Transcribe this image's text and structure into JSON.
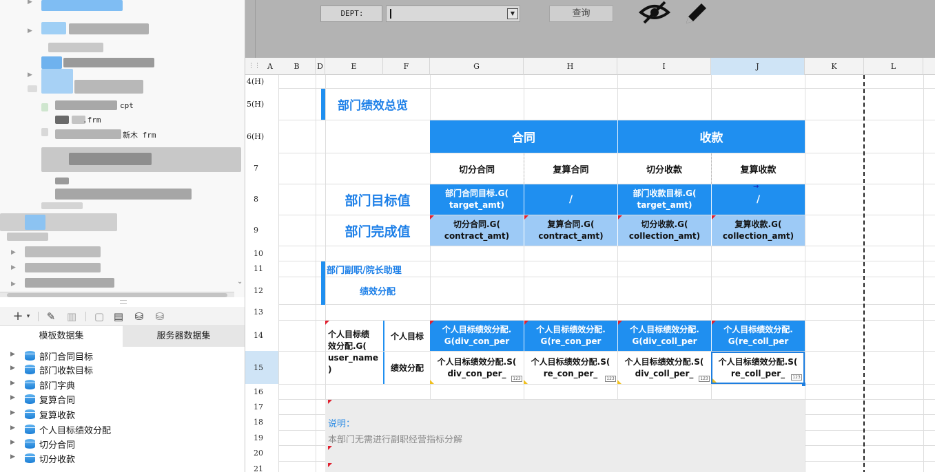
{
  "left_panel": {
    "file_suffixes": [
      "cpt",
      ".frm",
      "新木 frm"
    ],
    "toolbar_icons": [
      "add-icon",
      "edit-icon",
      "delete-icon",
      "preview-icon",
      "edit-dataset-icon",
      "database-icon",
      "database-settings-icon"
    ],
    "tabs": {
      "template": "模板数据集",
      "server": "服务器数据集"
    },
    "datasets": [
      "部门合同目标",
      "部门收款目标",
      "部门字典",
      "复算合同",
      "复算收款",
      "个人目标绩效分配",
      "切分合同",
      "切分收款"
    ]
  },
  "param_bar": {
    "dept_label": "DEPT:",
    "dept_value": "",
    "query_label": "查询"
  },
  "grid": {
    "columns": [
      "A",
      "B",
      "D",
      "E",
      "F",
      "G",
      "H",
      "I",
      "J",
      "K",
      "L"
    ],
    "selected_column": "J",
    "rows": [
      "4(H)",
      "5(H)",
      "6(H)",
      "7",
      "8",
      "9",
      "10",
      "11",
      "12",
      "13",
      "14",
      "15",
      "16",
      "17",
      "18",
      "19",
      "20",
      "21"
    ],
    "cells": {
      "overview_title": "部门绩效总览",
      "contract_header": "合同",
      "collection_header": "收款",
      "split_contract": "切分合同",
      "recalc_contract": "复算合同",
      "split_collection": "切分收款",
      "recalc_collection": "复算收款",
      "dept_target_label": "部门目标值",
      "dept_done_label": "部门完成值",
      "target_contract": "部门合同目标.G(",
      "target_contract_2": "target_amt)",
      "target_slash_h": "/",
      "target_collection": "部门收款目标.G(",
      "target_collection_2": "target_amt)",
      "target_slash_j": "/",
      "done_split_contract": "切分合同.G(",
      "done_split_contract_2": "contract_amt)",
      "done_recalc_contract": "复算合同.G(",
      "done_recalc_contract_2": "contract_amt)",
      "done_split_collection": "切分收款.G(",
      "done_split_collection_2": "collection_amt)",
      "done_recalc_collection": "复算收款.G(",
      "done_recalc_collection_2": "collection_amt)",
      "deputy_title": "部门副职/院长助理",
      "deputy_title_2": "绩效分配",
      "person_field_1": "个人目标绩",
      "person_field_2": "效分配.G(",
      "person_field_3": "user_name",
      "person_field_4": ")",
      "personal_target": "个人目标",
      "perf_alloc": "绩效分配",
      "r14_g_1": "个人目标绩效分配.",
      "r14_g_2": "G(div_con_per",
      "r14_h_1": "个人目标绩效分配.",
      "r14_h_2": "G(re_con_per",
      "r14_i_1": "个人目标绩效分配.",
      "r14_i_2": "G(div_coll_per",
      "r14_j_1": "个人目标绩效分配.",
      "r14_j_2": "G(re_coll_per",
      "r15_g_1": "个人目标绩效分配.S(",
      "r15_g_2": "div_con_per_",
      "r15_h_1": "个人目标绩效分配.S(",
      "r15_h_2": "re_con_per_",
      "r15_i_1": "个人目标绩效分配.S(",
      "r15_i_2": "div_coll_per_",
      "r15_j_1": "个人目标绩效分配.S(",
      "r15_j_2": "re_coll_per_",
      "tag": "123",
      "note_label": "说明：",
      "note_text": "本部门无需进行副职经营指标分解"
    }
  },
  "colors": {
    "header_blue": "#1f8ff0",
    "light_blue": "#9dcaf6",
    "title_blue": "#1e80e8",
    "param_bar_gray": "#b3b3b3"
  }
}
